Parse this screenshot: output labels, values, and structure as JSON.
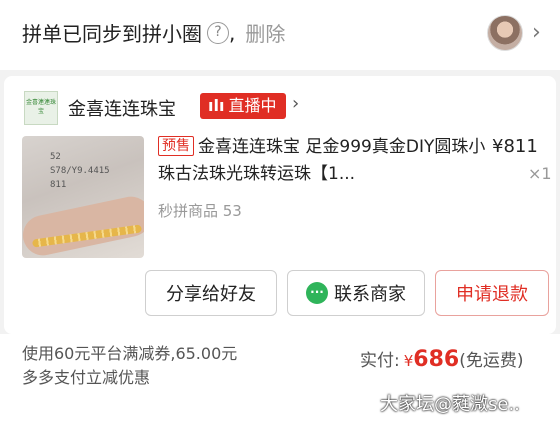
{
  "header": {
    "sync_text": "拼单已同步到拼小圈",
    "help_symbol": "?",
    "comma": ",",
    "delete_label": "删除",
    "chevron": "›"
  },
  "shop": {
    "logo_text": "金喜連連珠宝",
    "name": "金喜连连珠宝",
    "live_icon": "ılı",
    "live_label": "直播中",
    "chevron": "›"
  },
  "product": {
    "image_note": "52\nS78/Y9.4415\n811",
    "presale_tag": "预售",
    "title": "金喜连连珠宝 足金999真金DIY圆珠小珠古法珠光珠转运珠【1...",
    "price": "¥811",
    "quantity": "×1",
    "group_info": "秒拼商品 53"
  },
  "actions": {
    "share_label": "分享给好友",
    "contact_label": "联系商家",
    "refund_label": "申请退款"
  },
  "footer": {
    "discount_text": "使用60元平台满减券,65.00元多多支付立减优惠",
    "paid_label": "实付:",
    "currency": "¥",
    "paid_amount": "686",
    "shipping_note": "(免运费)",
    "watermark": "大家坛@蕤溦se.."
  },
  "colors": {
    "accent": "#e02e24",
    "chat_green": "#2fb45a"
  }
}
